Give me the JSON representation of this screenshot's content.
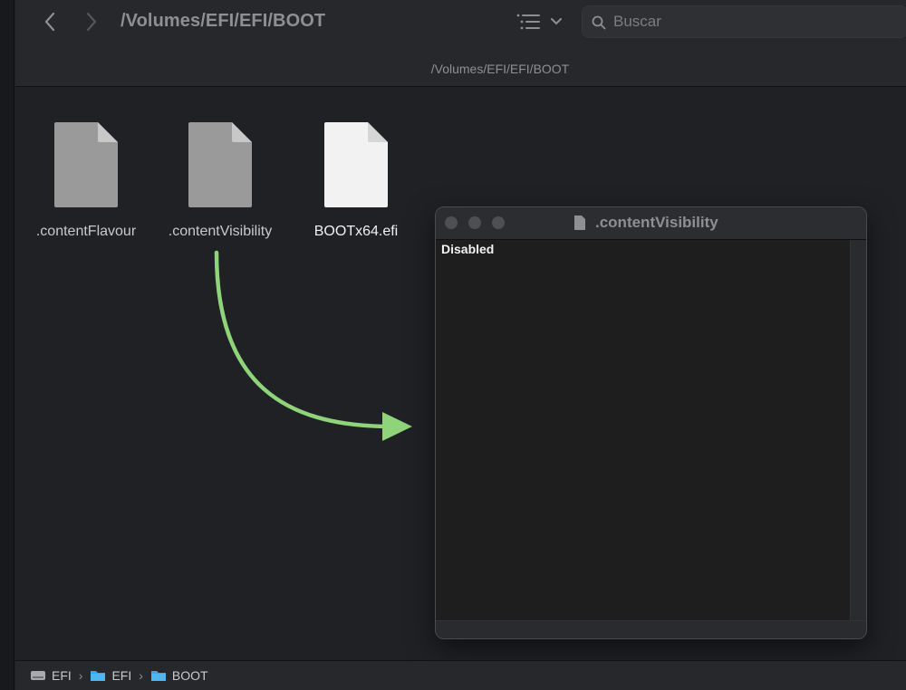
{
  "toolbar": {
    "title": "/Volumes/EFI/EFI/BOOT",
    "subtitle": "/Volumes/EFI/EFI/BOOT",
    "back_icon": "chevron-left-icon",
    "forward_icon": "chevron-right-icon",
    "view_icon": "list-view-icon",
    "search": {
      "placeholder": "Buscar",
      "value": ""
    }
  },
  "files": [
    {
      "name": ".contentFlavour",
      "icon": "document-icon",
      "color": "#9a9a9a"
    },
    {
      "name": ".contentVisibility",
      "icon": "document-icon",
      "color": "#9a9a9a"
    },
    {
      "name": "BOOTx64.efi",
      "icon": "document-icon",
      "color": "#f2f2f2"
    }
  ],
  "editor": {
    "title": ".contentVisibility",
    "content": "Disabled"
  },
  "annotation": {
    "color": "#8fd37a"
  },
  "pathbar": {
    "items": [
      {
        "label": "EFI",
        "icon": "drive-icon"
      },
      {
        "label": "EFI",
        "icon": "folder-icon"
      },
      {
        "label": "BOOT",
        "icon": "folder-icon"
      }
    ],
    "separator": "›"
  }
}
